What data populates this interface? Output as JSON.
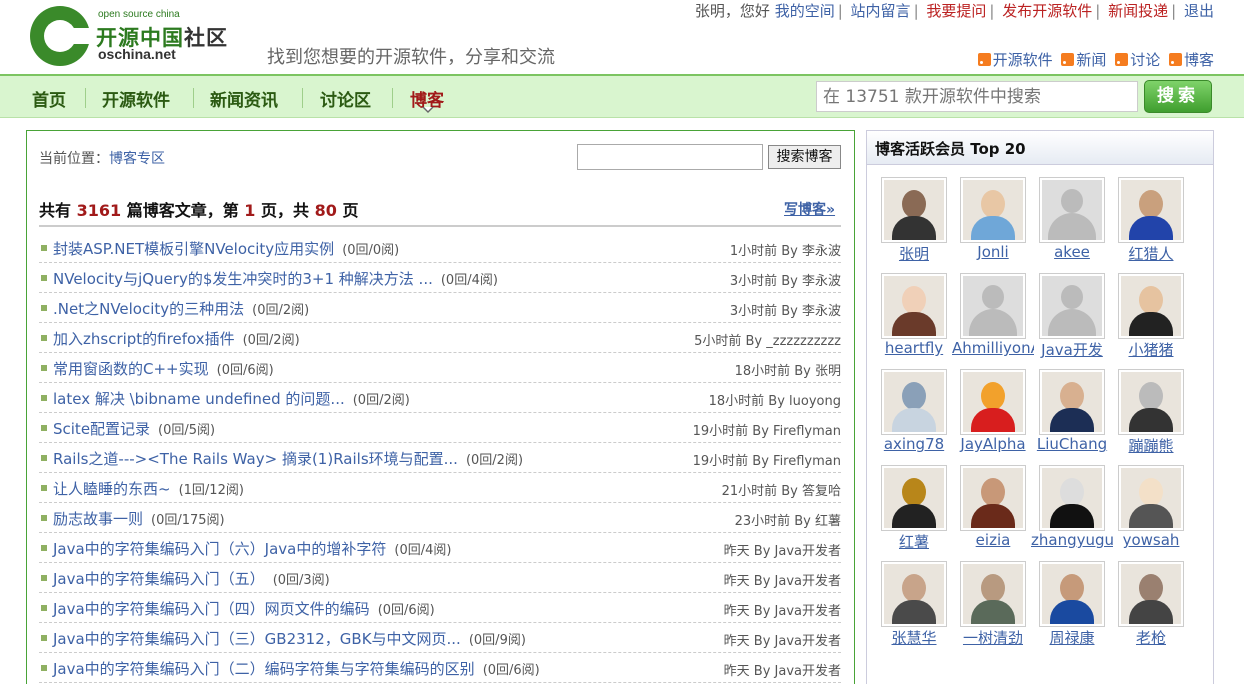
{
  "header": {
    "logo_small": "open source china",
    "logo_cn_green": "开源中国",
    "logo_cn_dark": "社区",
    "logo_en": "oschina.net",
    "slogan": "找到您想要的开源软件，分享和交流",
    "user_greeting": "张明，您好",
    "top_links": [
      "我的空间",
      "站内留言",
      "我要提问",
      "发布开源软件",
      "新闻投递",
      "退出"
    ],
    "rss_links": [
      "开源软件",
      "新闻",
      "讨论",
      "博客"
    ]
  },
  "nav": {
    "items": [
      "首页",
      "开源软件",
      "新闻资讯",
      "讨论区",
      "博客"
    ],
    "active": "博客",
    "search_placeholder": "在 13751 款开源软件中搜索",
    "search_button": "搜索"
  },
  "main": {
    "breadcrumb_label": "当前位置：",
    "breadcrumb_link": "博客专区",
    "blog_search_button": "搜索博客",
    "summary": {
      "prefix": "共有",
      "total": "3161",
      "mid1": "篇博客文章，第",
      "page": "1",
      "mid2": "页，共",
      "pages": "80",
      "suffix": "页"
    },
    "write_link": "写博客»",
    "posts": [
      {
        "title": "封装ASP.NET模板引擎NVelocity应用实例",
        "stats": "(0回/0阅)",
        "meta": "1小时前 By 李永波"
      },
      {
        "title": "NVelocity与jQuery的$发生冲突时的3+1 种解决方法 ...",
        "stats": "(0回/4阅)",
        "meta": "3小时前 By 李永波"
      },
      {
        "title": ".Net之NVelocity的三种用法",
        "stats": "(0回/2阅)",
        "meta": "3小时前 By 李永波"
      },
      {
        "title": "加入zhscript的firefox插件",
        "stats": "(0回/2阅)",
        "meta": "5小时前 By _zzzzzzzzzz"
      },
      {
        "title": "常用窗函数的C++实现",
        "stats": "(0回/6阅)",
        "meta": "18小时前 By 张明"
      },
      {
        "title": "latex 解决 \\bibname undefined 的问题...",
        "stats": "(0回/2阅)",
        "meta": "18小时前 By luoyong"
      },
      {
        "title": "Scite配置记录",
        "stats": "(0回/5阅)",
        "meta": "19小时前 By Fireflyman"
      },
      {
        "title": "Rails之道---><The Rails Way> 摘录(1)Rails环境与配置...",
        "stats": "(0回/2阅)",
        "meta": "19小时前 By Fireflyman"
      },
      {
        "title": "让人瞌睡的东西~",
        "stats": "(1回/12阅)",
        "meta": "21小时前 By 答复哈"
      },
      {
        "title": "励志故事一则",
        "stats": "(0回/175阅)",
        "meta": "23小时前 By 红薯"
      },
      {
        "title": "Java中的字符集编码入门（六）Java中的增补字符",
        "stats": "(0回/4阅)",
        "meta": "昨天 By Java开发者"
      },
      {
        "title": "Java中的字符集编码入门（五）",
        "stats": "(0回/3阅)",
        "meta": "昨天 By Java开发者"
      },
      {
        "title": "Java中的字符集编码入门（四）网页文件的编码",
        "stats": "(0回/6阅)",
        "meta": "昨天 By Java开发者"
      },
      {
        "title": "Java中的字符集编码入门（三）GB2312，GBK与中文网页...",
        "stats": "(0回/9阅)",
        "meta": "昨天 By Java开发者"
      },
      {
        "title": "Java中的字符集编码入门（二）编码字符集与字符集编码的区别",
        "stats": "(0回/6阅)",
        "meta": "昨天 By Java开发者"
      }
    ]
  },
  "side": {
    "title": "博客活跃会员 Top 20",
    "members": [
      {
        "name": "张明",
        "avatar": "photo",
        "skin": "#8a6a55",
        "cloth": "#333"
      },
      {
        "name": "Jonli",
        "avatar": "photo",
        "skin": "#e8c7a5",
        "cloth": "#6fa7d8"
      },
      {
        "name": "akee",
        "avatar": "default"
      },
      {
        "name": "红猎人",
        "avatar": "photo",
        "skin": "#c9a07d",
        "cloth": "#2244aa"
      },
      {
        "name": "heartfly",
        "avatar": "photo",
        "skin": "#f0d0b8",
        "cloth": "#6a3a2a"
      },
      {
        "name": "AhmilliyonA",
        "avatar": "default"
      },
      {
        "name": "Java开发",
        "avatar": "default"
      },
      {
        "name": "小猪猪",
        "avatar": "photo",
        "skin": "#e6c3a0",
        "cloth": "#222"
      },
      {
        "name": "axing78",
        "avatar": "photo",
        "skin": "#8aa0b8",
        "cloth": "#c8d4e0"
      },
      {
        "name": "JayAlpha",
        "avatar": "photo",
        "skin": "#f2a12c",
        "cloth": "#d81e1e"
      },
      {
        "name": "LiuChang",
        "avatar": "photo",
        "skin": "#d8b090",
        "cloth": "#1c2e55"
      },
      {
        "name": "蹦蹦熊",
        "avatar": "photo",
        "skin": "#bbb",
        "cloth": "#333"
      },
      {
        "name": "红薯",
        "avatar": "photo",
        "skin": "#b8861a",
        "cloth": "#222"
      },
      {
        "name": "eizia",
        "avatar": "photo",
        "skin": "#c89878",
        "cloth": "#6a2a1a"
      },
      {
        "name": "zhangyugua",
        "avatar": "photo",
        "skin": "#ddd",
        "cloth": "#111"
      },
      {
        "name": "yowsah",
        "avatar": "photo",
        "skin": "#f3e0c8",
        "cloth": "#555"
      },
      {
        "name": "张慧华",
        "avatar": "photo",
        "skin": "#c8a48a",
        "cloth": "#4a4a4a"
      },
      {
        "name": "一树清劲",
        "avatar": "photo",
        "skin": "#b89a80",
        "cloth": "#5a6a5a"
      },
      {
        "name": "周禄康",
        "avatar": "photo",
        "skin": "#c69a7a",
        "cloth": "#1a4aa0"
      },
      {
        "name": "老枪",
        "avatar": "photo",
        "skin": "#9a8070",
        "cloth": "#444"
      }
    ]
  }
}
